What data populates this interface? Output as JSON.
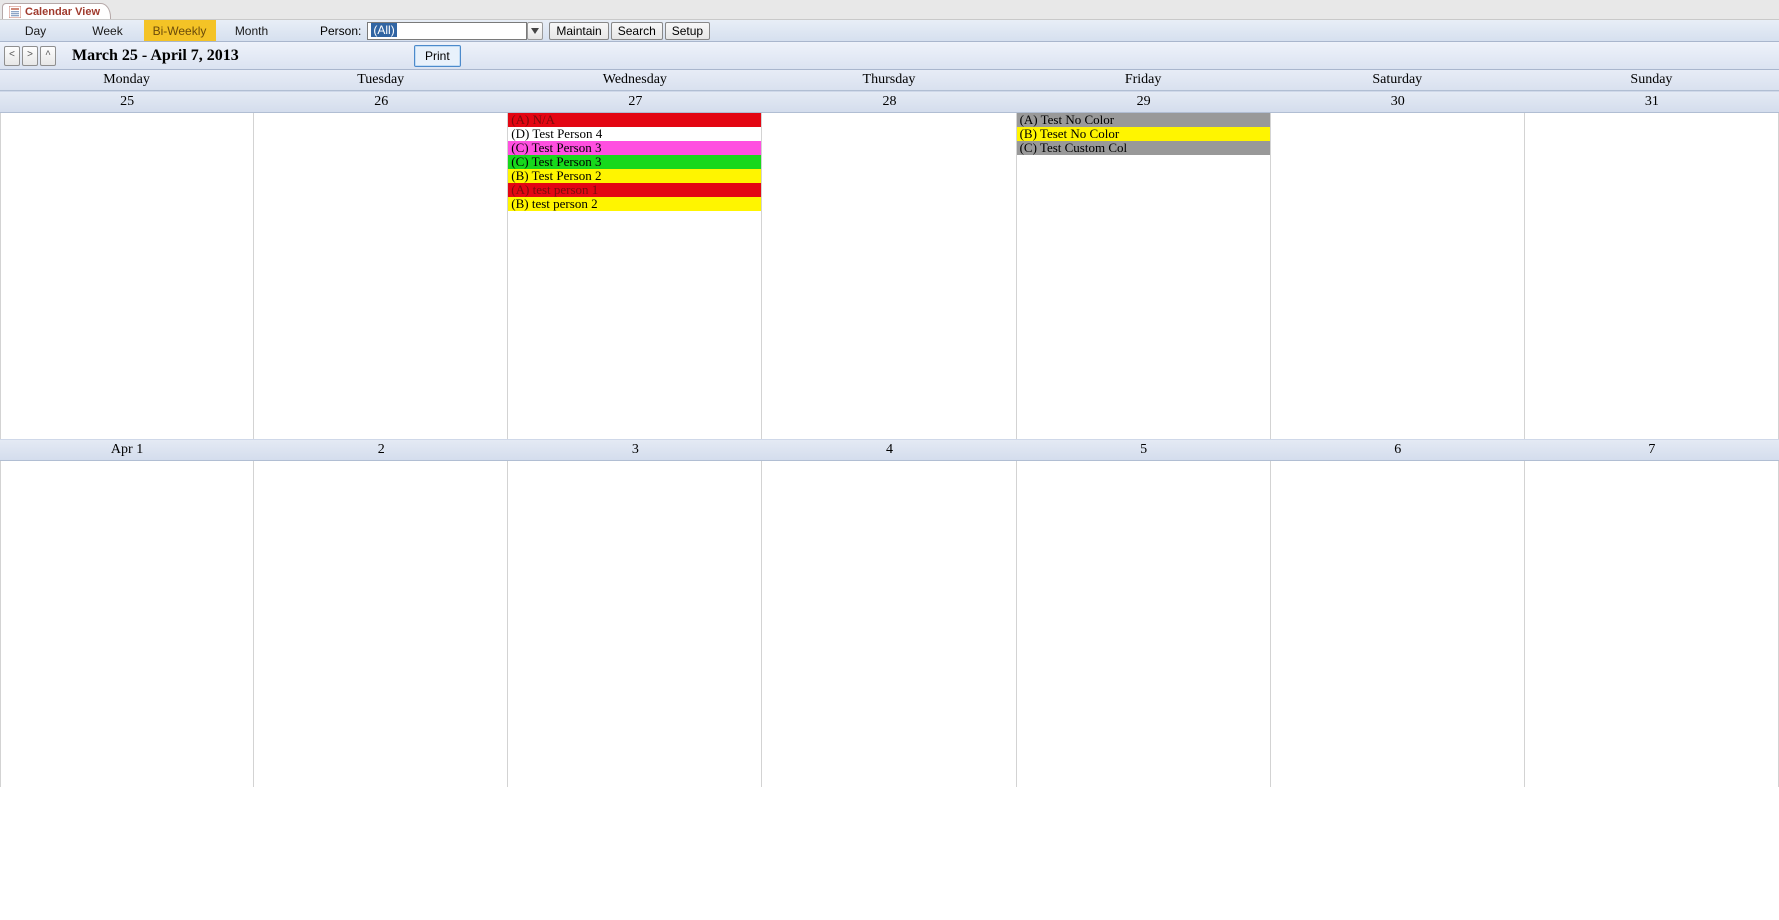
{
  "tab": {
    "label": "Calendar View"
  },
  "toolbar": {
    "view_modes": {
      "day": "Day",
      "week": "Week",
      "biweekly": "Bi-Weekly",
      "month": "Month",
      "active": "biweekly"
    },
    "person_label": "Person:",
    "person_value": "(All)",
    "maintain": "Maintain",
    "search": "Search",
    "setup": "Setup"
  },
  "nav": {
    "date_range": "March 25 - April 7, 2013",
    "print": "Print"
  },
  "day_headers": [
    "Monday",
    "Tuesday",
    "Wednesday",
    "Thursday",
    "Friday",
    "Saturday",
    "Sunday"
  ],
  "week1": {
    "dates": [
      "25",
      "26",
      "27",
      "28",
      "29",
      "30",
      "31"
    ],
    "events": {
      "0": [],
      "1": [],
      "2": [
        {
          "label": "(A) N/A",
          "bg": "#e30613",
          "fg": "#7a0c0c"
        },
        {
          "label": "(D) Test Person 4",
          "bg": "#ffffff",
          "fg": "#000000"
        },
        {
          "label": "(C) Test Person 3",
          "bg": "#ff4fe0",
          "fg": "#000000"
        },
        {
          "label": "(C) Test Person 3",
          "bg": "#17d81c",
          "fg": "#000000"
        },
        {
          "label": "(B) Test Person 2",
          "bg": "#fff500",
          "fg": "#000000"
        },
        {
          "label": "(A) test person 1",
          "bg": "#e30613",
          "fg": "#7a0c0c"
        },
        {
          "label": "(B) test person 2",
          "bg": "#fff500",
          "fg": "#000000"
        }
      ],
      "3": [],
      "4": [
        {
          "label": "(A) Test No Color",
          "bg": "#999999",
          "fg": "#000000"
        },
        {
          "label": "(B) Teset No Color",
          "bg": "#fff500",
          "fg": "#000000"
        },
        {
          "label": "(C) Test Custom Col",
          "bg": "#999999",
          "fg": "#000000"
        }
      ],
      "5": [],
      "6": []
    }
  },
  "week2": {
    "dates": [
      "Apr 1",
      "2",
      "3",
      "4",
      "5",
      "6",
      "7"
    ],
    "events": {
      "0": [],
      "1": [],
      "2": [],
      "3": [],
      "4": [],
      "5": [],
      "6": []
    }
  }
}
